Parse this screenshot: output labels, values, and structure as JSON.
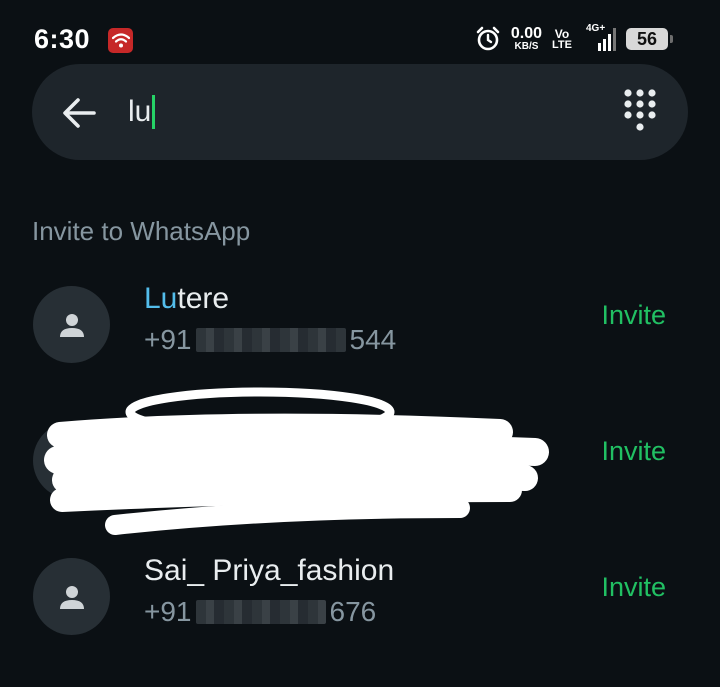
{
  "status_bar": {
    "time": "6:30",
    "speed_value": "0.00",
    "speed_unit": "KB/S",
    "volte_top": "Vo",
    "volte_bottom": "LTE",
    "network_label": "4G+",
    "battery": "56",
    "icons": [
      "shield-wifi-icon",
      "alarm-icon",
      "signal-icon",
      "battery-icon"
    ]
  },
  "search": {
    "query": "lu",
    "back_icon": "arrow-left-icon",
    "dialpad_icon": "dialpad-icon"
  },
  "section": {
    "title": "Invite to WhatsApp"
  },
  "contacts": [
    {
      "name_highlight": "Lu",
      "name_rest": "tere",
      "phone_prefix": "+91 ",
      "phone_suffix": "544",
      "invite_label": "Invite"
    },
    {
      "name_highlight": "",
      "name_rest": "",
      "phone_prefix": "",
      "phone_suffix": "",
      "invite_label": "Invite"
    },
    {
      "name_highlight": "",
      "name_rest": "Sai_ Priya_fashion",
      "phone_prefix": "+91 ",
      "phone_suffix": "676",
      "invite_label": "Invite"
    }
  ],
  "colors": {
    "background": "#0b1014",
    "search_bg": "#1e252b",
    "accent_green": "#21c063",
    "highlight_blue": "#53bdeb",
    "secondary_text": "#8696a0"
  }
}
